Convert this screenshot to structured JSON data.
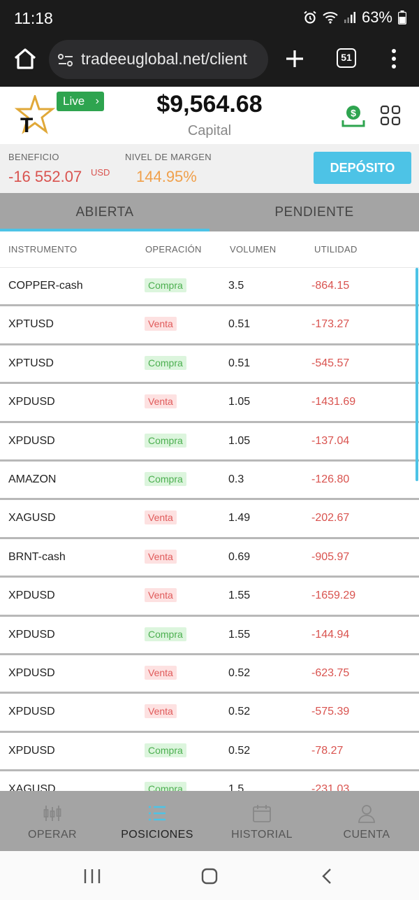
{
  "status_bar": {
    "time": "11:18",
    "battery": "63%"
  },
  "browser": {
    "url": "tradeeuglobal.net/client",
    "tab_count": "51"
  },
  "header": {
    "live_label": "Live",
    "capital_amount": "$9,564.68",
    "capital_label": "Capital"
  },
  "summary": {
    "benefit_label": "BENEFICIO",
    "benefit_value": "-16 552.07",
    "benefit_unit": "USD",
    "margin_label": "NIVEL DE MARGEN",
    "margin_value": "144.95%",
    "deposit_label": "DEPÓSITO"
  },
  "tabs": [
    {
      "label": "ABIERTA"
    },
    {
      "label": "PENDIENTE"
    }
  ],
  "table": {
    "headers": [
      "INSTRUMENTO",
      "OPERACIÓN",
      "VOLUMEN",
      "UTILIDAD"
    ],
    "rows": [
      {
        "instrument": "COPPER-cash",
        "operation": "Compra",
        "volume": "3.5",
        "profit": "-864.15"
      },
      {
        "instrument": "XPTUSD",
        "operation": "Venta",
        "volume": "0.51",
        "profit": "-173.27"
      },
      {
        "instrument": "XPTUSD",
        "operation": "Compra",
        "volume": "0.51",
        "profit": "-545.57"
      },
      {
        "instrument": "XPDUSD",
        "operation": "Venta",
        "volume": "1.05",
        "profit": "-1431.69"
      },
      {
        "instrument": "XPDUSD",
        "operation": "Compra",
        "volume": "1.05",
        "profit": "-137.04"
      },
      {
        "instrument": "AMAZON",
        "operation": "Compra",
        "volume": "0.3",
        "profit": "-126.80"
      },
      {
        "instrument": "XAGUSD",
        "operation": "Venta",
        "volume": "1.49",
        "profit": "-202.67"
      },
      {
        "instrument": "BRNT-cash",
        "operation": "Venta",
        "volume": "0.69",
        "profit": "-905.97"
      },
      {
        "instrument": "XPDUSD",
        "operation": "Venta",
        "volume": "1.55",
        "profit": "-1659.29"
      },
      {
        "instrument": "XPDUSD",
        "operation": "Compra",
        "volume": "1.55",
        "profit": "-144.94"
      },
      {
        "instrument": "XPDUSD",
        "operation": "Venta",
        "volume": "0.52",
        "profit": "-623.75"
      },
      {
        "instrument": "XPDUSD",
        "operation": "Venta",
        "volume": "0.52",
        "profit": "-575.39"
      },
      {
        "instrument": "XPDUSD",
        "operation": "Compra",
        "volume": "0.52",
        "profit": "-78.27"
      },
      {
        "instrument": "XAGUSD",
        "operation": "Compra",
        "volume": "1.5",
        "profit": "-231.03"
      }
    ]
  },
  "bottom_nav": [
    {
      "label": "OPERAR",
      "icon": "candlestick-icon"
    },
    {
      "label": "POSICIONES",
      "icon": "list-icon"
    },
    {
      "label": "HISTORIAL",
      "icon": "calendar-icon"
    },
    {
      "label": "CUENTA",
      "icon": "user-icon"
    }
  ],
  "colors": {
    "accent": "#4dc3e6",
    "live_green": "#2ea44f",
    "negative": "#d9534f",
    "margin": "#f0a04b",
    "buy_text": "#4caf50",
    "sell_text": "#e05a5a"
  }
}
